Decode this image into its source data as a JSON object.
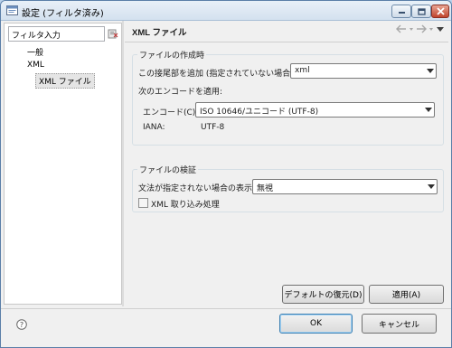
{
  "window": {
    "title": "設定 (フィルタ済み)"
  },
  "left": {
    "filter_value": "フィルタ入力",
    "tree": [
      {
        "label": "一般"
      },
      {
        "label": "XML"
      },
      {
        "label": "XML ファイル"
      }
    ]
  },
  "right": {
    "page_title": "XML ファイル",
    "creating": {
      "legend": "ファイルの作成時",
      "prefix_label": "この接尾部を追加 (指定されていない場合):",
      "prefix_value": "xml",
      "encoding_section_label": "次のエンコードを適用:",
      "encoding_label": "エンコード(C):",
      "encoding_value": "ISO 10646/ユニコード (UTF-8)",
      "iana_label": "IANA:",
      "iana_value": "UTF-8"
    },
    "validating": {
      "legend": "ファイルの検証",
      "grammar_label": "文法が指定されない場合の表示:",
      "grammar_value": "無視",
      "xinclude_label": "XML 取り込み処理"
    },
    "restore_defaults": "デフォルトの復元(D)",
    "apply": "適用(A)"
  },
  "footer": {
    "ok": "OK",
    "cancel": "キャンセル"
  }
}
